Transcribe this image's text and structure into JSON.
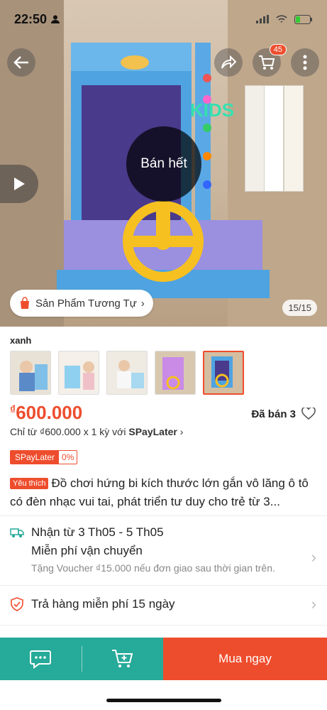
{
  "status_bar": {
    "time": "22:50"
  },
  "top_nav": {
    "cart_count": "45"
  },
  "hero": {
    "sold_out_label": "Bán hết",
    "similar_label": "Sản Phẩm Tương Tự",
    "pager": "15/15",
    "brand_text": "KIDS"
  },
  "variation": {
    "label": "xanh",
    "selected_index": 4
  },
  "price": {
    "currency": "₫",
    "amount": "600.000"
  },
  "sold": {
    "label": "Đã bán 3"
  },
  "installment": {
    "prefix": "Chỉ từ ₫600.000 x 1 kỳ với ",
    "brand": "SPayLater"
  },
  "spay_badge": {
    "name": "SPayLater",
    "rate": "0%"
  },
  "product": {
    "badge": "Yêu thích",
    "title": "Đồ chơi hứng bi kích thước lớn gắn vô lăng ô tô có đèn nhạc vui tai, phát triển tư duy cho trẻ từ 3..."
  },
  "shipping": {
    "date": "Nhận từ 3 Th05 - 5 Th05",
    "free": "Miễn phí vận chuyển",
    "voucher": "Tặng Voucher ₫15.000 nếu đơn giao sau thời gian trên."
  },
  "returns": {
    "label": "Trả hàng miễn phí 15 ngày"
  },
  "bottom_bar": {
    "buy_now": "Mua ngay"
  },
  "colors": {
    "brand": "#ee4d2d",
    "teal": "#26aa99"
  }
}
